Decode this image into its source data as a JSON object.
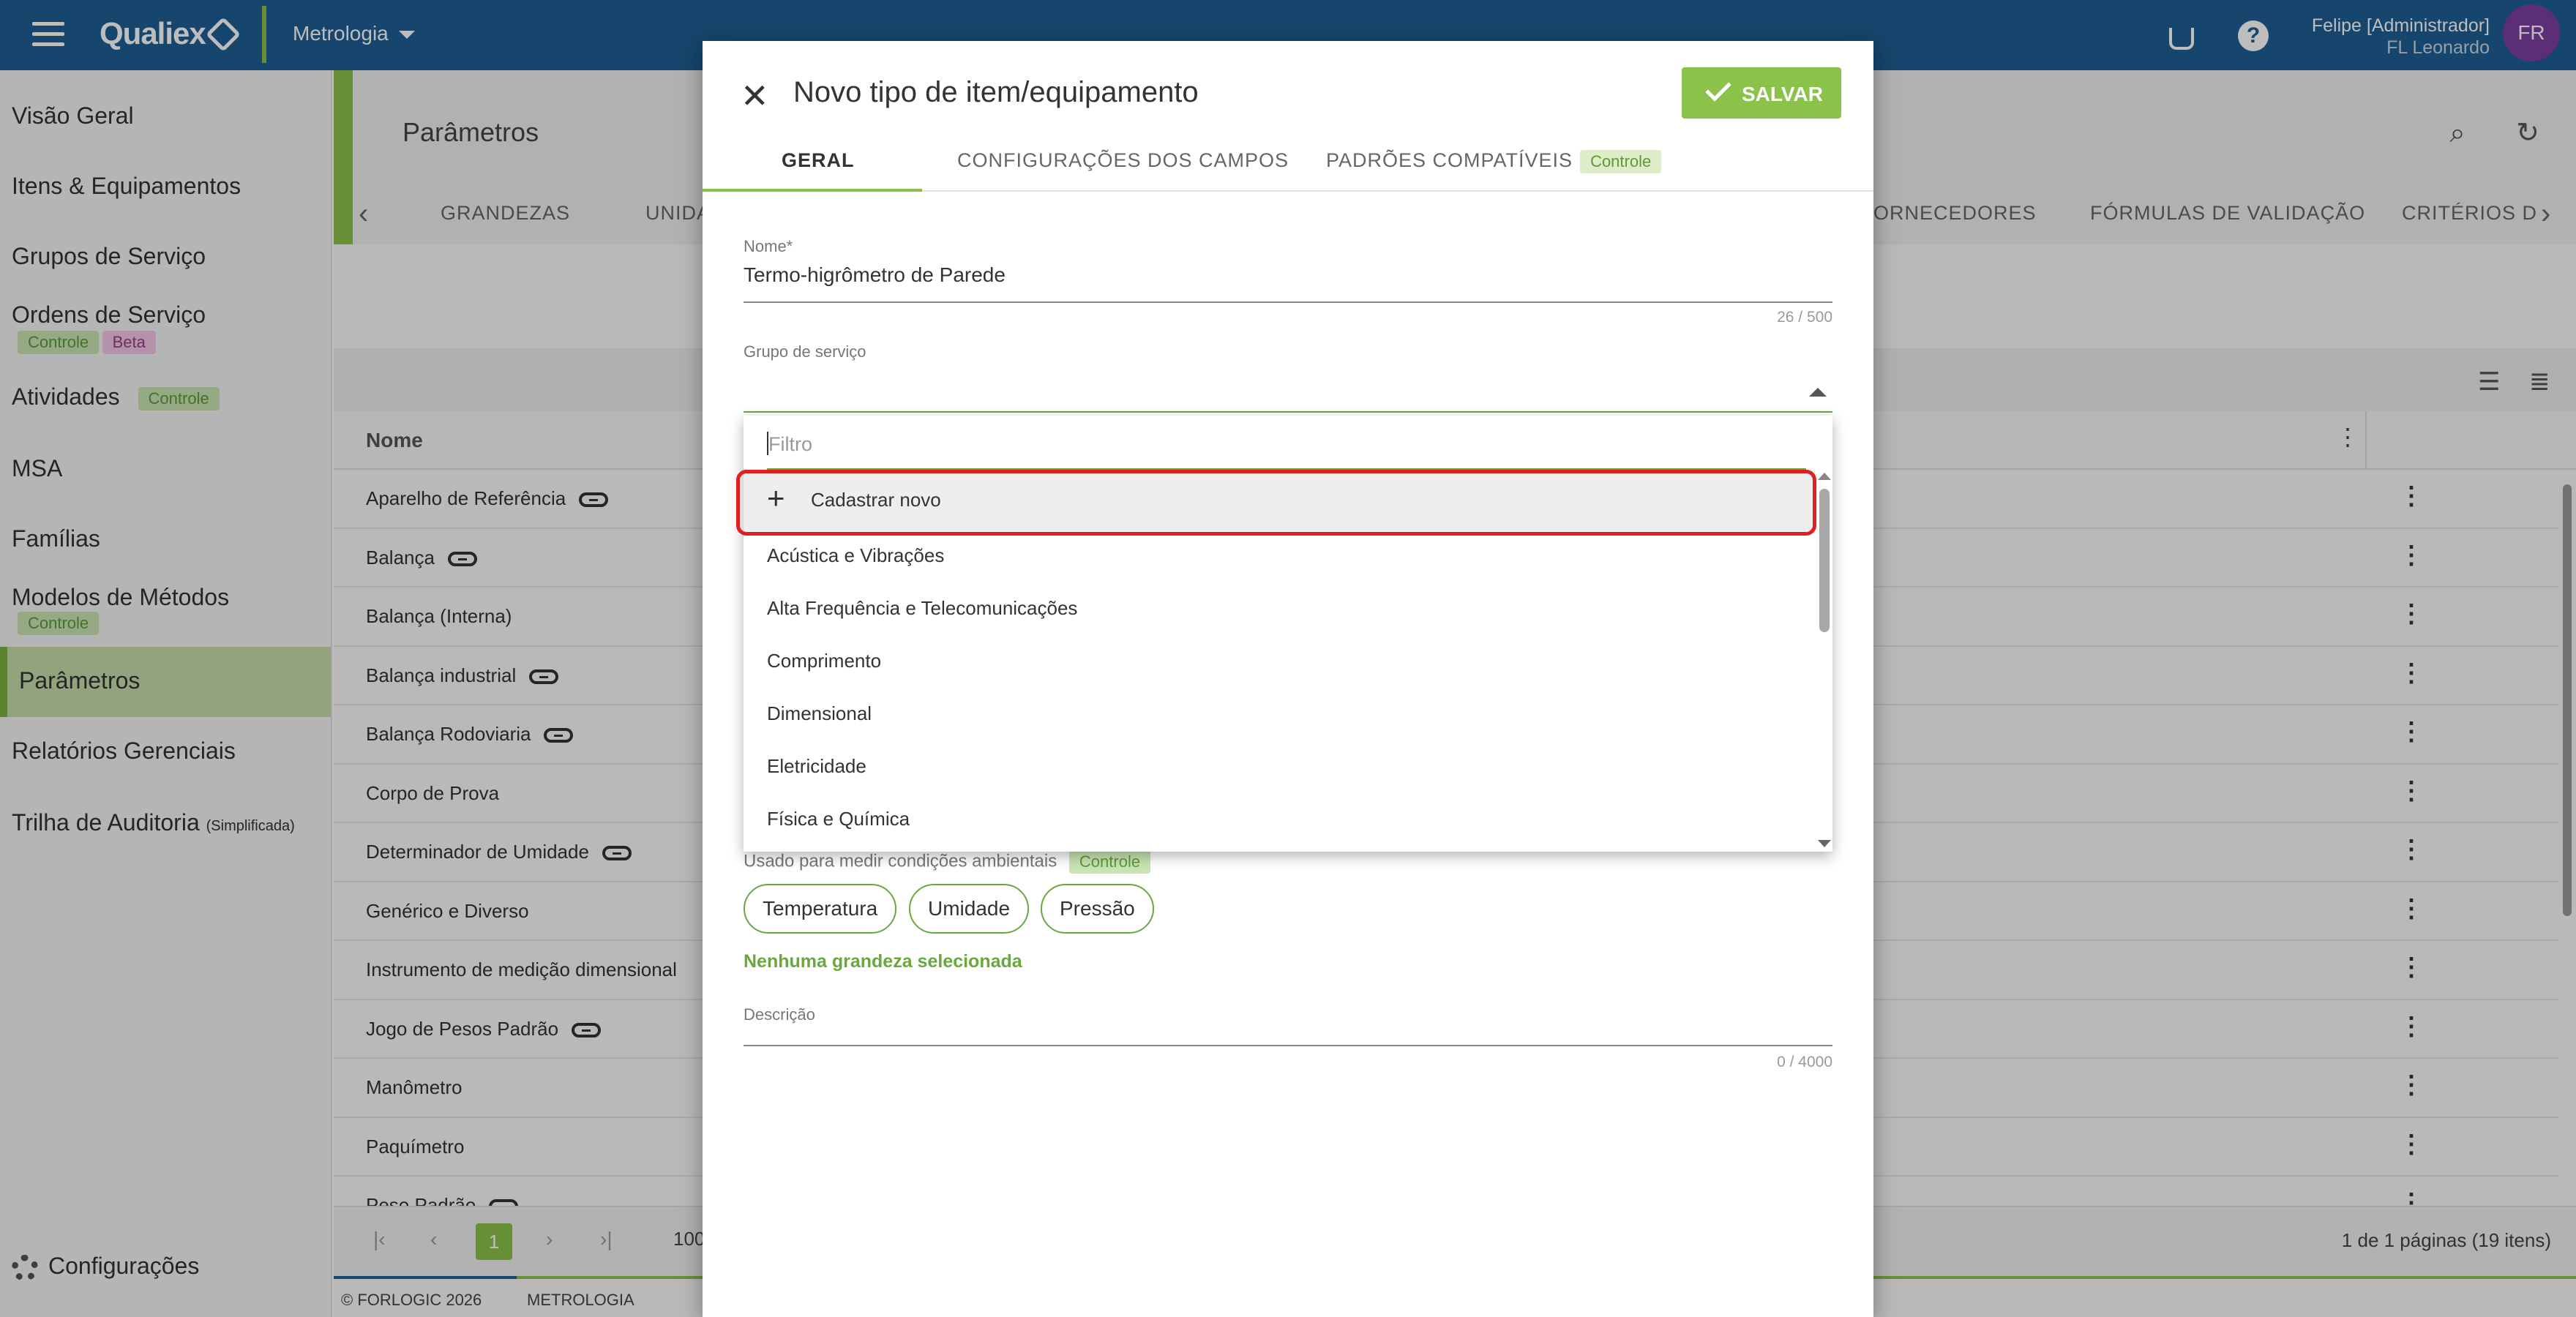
{
  "topbar": {
    "brand": "Qualiex",
    "module": "Metrologia",
    "help_glyph": "?",
    "user_name": "Felipe [Administrador]",
    "user_company": "FL Leonardo",
    "avatar_initials": "FR"
  },
  "sidebar": {
    "items": [
      {
        "label": "Visão Geral"
      },
      {
        "label": "Itens & Equipamentos"
      },
      {
        "label": "Grupos de Serviço"
      },
      {
        "label": "Ordens de Serviço",
        "badges": [
          "Controle",
          "Beta"
        ]
      },
      {
        "label": "Atividades",
        "badges": [
          "Controle"
        ]
      },
      {
        "label": "MSA"
      },
      {
        "label": "Famílias"
      },
      {
        "label": "Modelos de Métodos",
        "badges": [
          "Controle"
        ]
      },
      {
        "label": "Parâmetros"
      },
      {
        "label": "Relatórios Gerenciais"
      },
      {
        "label": "Trilha de Auditoria",
        "suffix": "(Simplificada)"
      }
    ],
    "settings_label": "Configurações"
  },
  "main": {
    "title": "Parâmetros",
    "tabs": [
      "GRANDEZAS",
      "UNIDA",
      "ORNECEDORES",
      "FÓRMULAS DE VALIDAÇÃO",
      "CRITÉRIOS D"
    ],
    "column_name": "Nome",
    "rows": [
      {
        "name": "Aparelho de Referência",
        "linked": true
      },
      {
        "name": "Balança",
        "linked": true
      },
      {
        "name": "Balança (Interna)",
        "linked": false
      },
      {
        "name": "Balança industrial",
        "linked": true
      },
      {
        "name": "Balança Rodoviaria",
        "linked": true
      },
      {
        "name": "Corpo de Prova",
        "linked": false
      },
      {
        "name": "Determinador de Umidade",
        "linked": true
      },
      {
        "name": "Genérico e Diverso",
        "linked": false
      },
      {
        "name": "Instrumento de medição dimensional",
        "linked": false
      },
      {
        "name": "Jogo de Pesos Padrão",
        "linked": true
      },
      {
        "name": "Manômetro",
        "linked": false
      },
      {
        "name": "Paquímetro",
        "linked": false
      },
      {
        "name": "Peso Padrão",
        "linked": true
      }
    ],
    "pager": {
      "current": "1",
      "page_size": "100",
      "info": "1 de 1 páginas (19 itens)"
    },
    "footer": {
      "copyright": "© FORLOGIC 2026",
      "module": "METROLOGIA"
    }
  },
  "modal": {
    "title": "Novo tipo de item/equipamento",
    "save_label": "SALVAR",
    "tabs": [
      {
        "label": "GERAL",
        "active": true
      },
      {
        "label": "CONFIGURAÇÕES DOS CAMPOS"
      },
      {
        "label": "PADRÕES COMPATÍVEIS",
        "badge": "Controle"
      }
    ],
    "name_field": {
      "label": "Nome*",
      "value": "Termo-higrômetro de Parede",
      "counter": "26 / 500"
    },
    "group_field": {
      "label": "Grupo de serviço",
      "value": ""
    },
    "dropdown": {
      "filter_placeholder": "Filtro",
      "new_option": "Cadastrar novo",
      "options": [
        "Acústica e Vibrações",
        "Alta Frequência e Telecomunicações",
        "Comprimento",
        "Dimensional",
        "Eletricidade",
        "Física e Química"
      ]
    },
    "env_note": "Usado para medir condições ambientais",
    "env_badge": "Controle",
    "quantities": [
      "Temperatura",
      "Umidade",
      "Pressão"
    ],
    "none_selected": "Nenhuma grandeza selecionada",
    "description_field": {
      "label": "Descrição",
      "counter": "0 / 4000"
    }
  },
  "colors": {
    "topbar": "#1e5e94",
    "accent_green": "#8bc34a",
    "highlight_red": "#e02020",
    "avatar": "#7b3fa0"
  }
}
